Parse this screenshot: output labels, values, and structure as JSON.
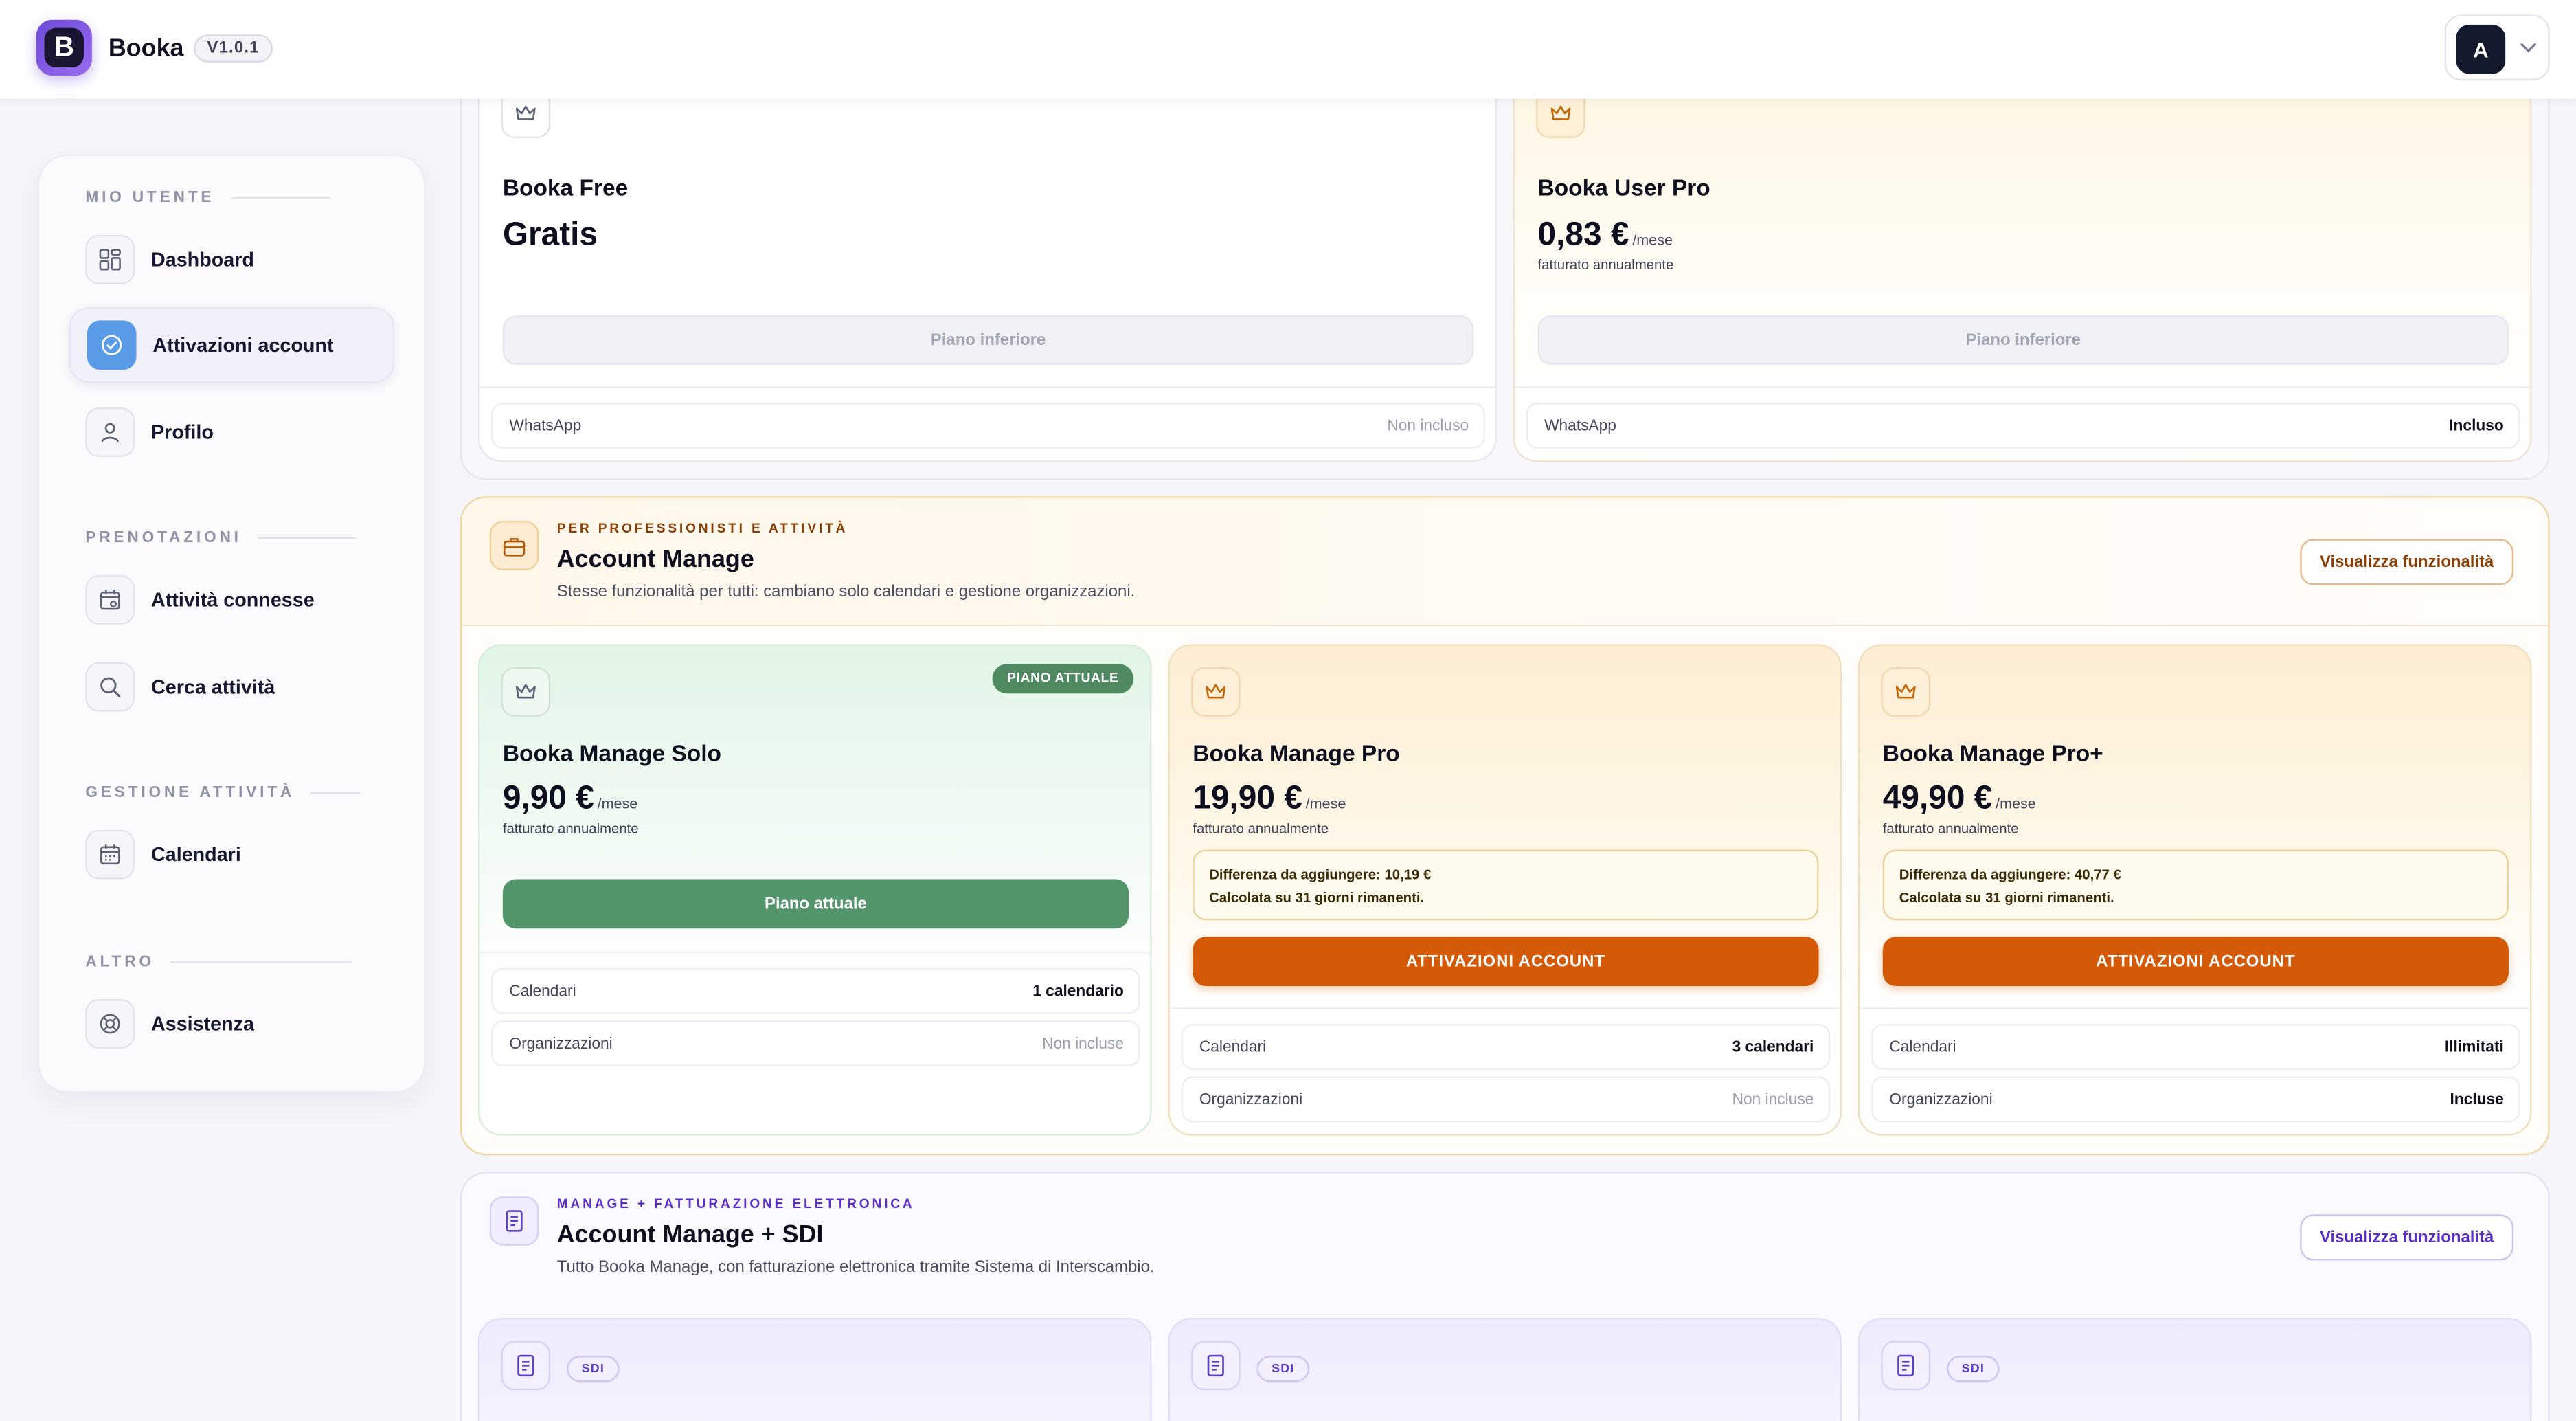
{
  "header": {
    "logo_letter": "B",
    "app_name": "Booka",
    "version": "V1.0.1",
    "avatar_initial": "A"
  },
  "sidebar": {
    "sections": [
      {
        "title": "MIO UTENTE",
        "items": [
          {
            "label": "Dashboard",
            "icon": "dashboard-grid-icon"
          },
          {
            "label": "Attivazioni account",
            "icon": "check-circle-icon",
            "active": true
          },
          {
            "label": "Profilo",
            "icon": "user-icon"
          }
        ]
      },
      {
        "title": "PRENOTAZIONI",
        "items": [
          {
            "label": "Attività connesse",
            "icon": "calendar-link-icon"
          },
          {
            "label": "Cerca attività",
            "icon": "search-icon"
          }
        ]
      },
      {
        "title": "GESTIONE ATTIVITÀ",
        "items": [
          {
            "label": "Calendari",
            "icon": "calendar-icon"
          }
        ]
      },
      {
        "title": "ALTRO",
        "items": [
          {
            "label": "Assistenza",
            "icon": "lifebuoy-icon"
          }
        ]
      }
    ]
  },
  "user_plans": {
    "free": {
      "name": "Booka Free",
      "price": "Gratis",
      "button": "Piano inferiore",
      "feature_key": "WhatsApp",
      "feature_val": "Non incluso"
    },
    "pro": {
      "name": "Booka User Pro",
      "price": "0,83 €",
      "period": "/mese",
      "billed": "fatturato annualmente",
      "button": "Piano inferiore",
      "feature_key": "WhatsApp",
      "feature_val": "Incluso"
    }
  },
  "manage_group": {
    "eyebrow": "PER PROFESSIONISTI E ATTIVITÀ",
    "title": "Account Manage",
    "description": "Stesse funzionalità per tutti: cambiano solo calendari e gestione organizzazioni.",
    "features_button": "Visualizza funzionalità",
    "accent": "#8a3d05",
    "plans": [
      {
        "name": "Booka Manage Solo",
        "badge": "PIANO ATTUALE",
        "price": "9,90 €",
        "period": "/mese",
        "billed": "fatturato annualmente",
        "button": "Piano attuale",
        "features": [
          {
            "k": "Calendari",
            "v": "1 calendario"
          },
          {
            "k": "Organizzazioni",
            "v": "Non incluse"
          }
        ]
      },
      {
        "name": "Booka Manage Pro",
        "price": "19,90 €",
        "period": "/mese",
        "billed": "fatturato annualmente",
        "diff_line1": "Differenza da aggiungere: 10,19 €",
        "diff_line2": "Calcolata su 31 giorni rimanenti.",
        "button": "ATTIVAZIONI ACCOUNT",
        "features": [
          {
            "k": "Calendari",
            "v": "3 calendari"
          },
          {
            "k": "Organizzazioni",
            "v": "Non incluse"
          }
        ]
      },
      {
        "name": "Booka Manage Pro+",
        "price": "49,90 €",
        "period": "/mese",
        "billed": "fatturato annualmente",
        "diff_line1": "Differenza da aggiungere: 40,77 €",
        "diff_line2": "Calcolata su 31 giorni rimanenti.",
        "button": "ATTIVAZIONI ACCOUNT",
        "features": [
          {
            "k": "Calendari",
            "v": "Illimitati"
          },
          {
            "k": "Organizzazioni",
            "v": "Incluse"
          }
        ]
      }
    ]
  },
  "sdi_group": {
    "eyebrow": "MANAGE + FATTURAZIONE ELETTRONICA",
    "title": "Account Manage + SDI",
    "description": "Tutto Booka Manage, con fatturazione elettronica tramite Sistema di Interscambio.",
    "features_button": "Visualizza funzionalità",
    "accent": "#5b2fc4",
    "badge": "SDI"
  },
  "colors": {
    "primary_purple": "#6d4bd8",
    "active_blue": "#5a9be8",
    "success_green": "#53956a",
    "cta_orange": "#d45a07"
  }
}
